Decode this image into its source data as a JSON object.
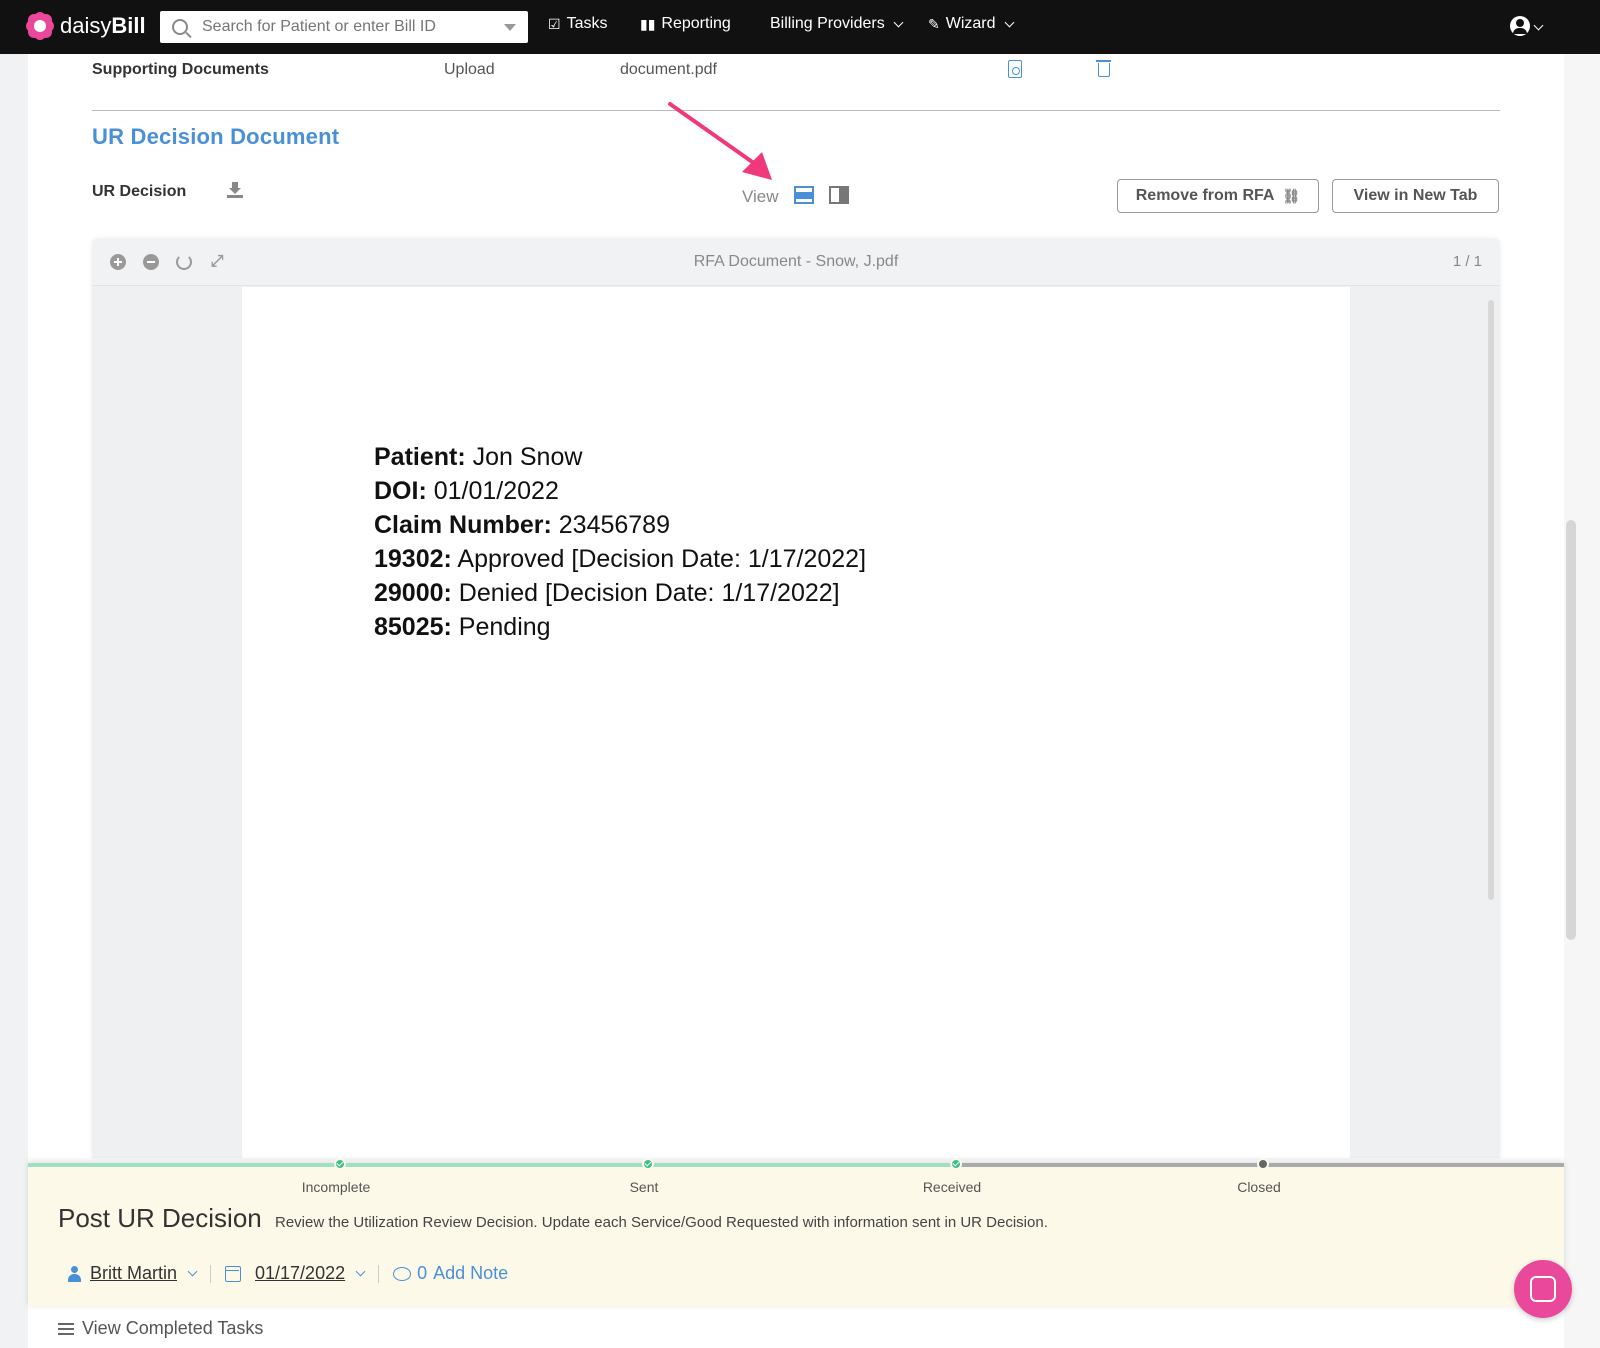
{
  "app": {
    "brand_light": "daisy",
    "brand_bold": "Bill",
    "accent": "#e9489b",
    "link": "#4a90d9"
  },
  "nav": {
    "search_placeholder": "Search for Patient or enter Bill ID",
    "tasks": "Tasks",
    "reporting": "Reporting",
    "billing_providers": "Billing Providers",
    "wizard": "Wizard"
  },
  "supporting": {
    "label": "Supporting Documents",
    "upload": "Upload",
    "file": "document.pdf"
  },
  "ur_section": {
    "title": "UR Decision Document",
    "label": "UR Decision",
    "view_label": "View",
    "remove_button": "Remove from RFA",
    "new_tab_button": "View in New Tab"
  },
  "viewer": {
    "title": "RFA Document - Snow, J.pdf",
    "page": "1 / 1",
    "lines": [
      {
        "key": "Patient:",
        "value": " Jon Snow"
      },
      {
        "key": "DOI:",
        "value": " 01/01/2022"
      },
      {
        "key": "Claim Number:",
        "value": " 23456789"
      },
      {
        "key": "19302:",
        "value": " Approved [Decision Date: 1/17/2022]"
      },
      {
        "key": "29000:",
        "value": " Denied [Decision Date: 1/17/2022]"
      },
      {
        "key": "85025:",
        "value": " Pending"
      }
    ]
  },
  "task": {
    "steps": [
      "Incomplete",
      "Sent",
      "Received",
      "Closed"
    ],
    "title": "Post UR Decision",
    "description": "Review the Utilization Review Decision. Update each Service/Good Requested with information sent in UR Decision.",
    "assignee": "Britt Martin",
    "date": "01/17/2022",
    "note_count": "0",
    "note_label": "Add Note"
  },
  "footer": {
    "completed_tasks": "View Completed Tasks"
  }
}
